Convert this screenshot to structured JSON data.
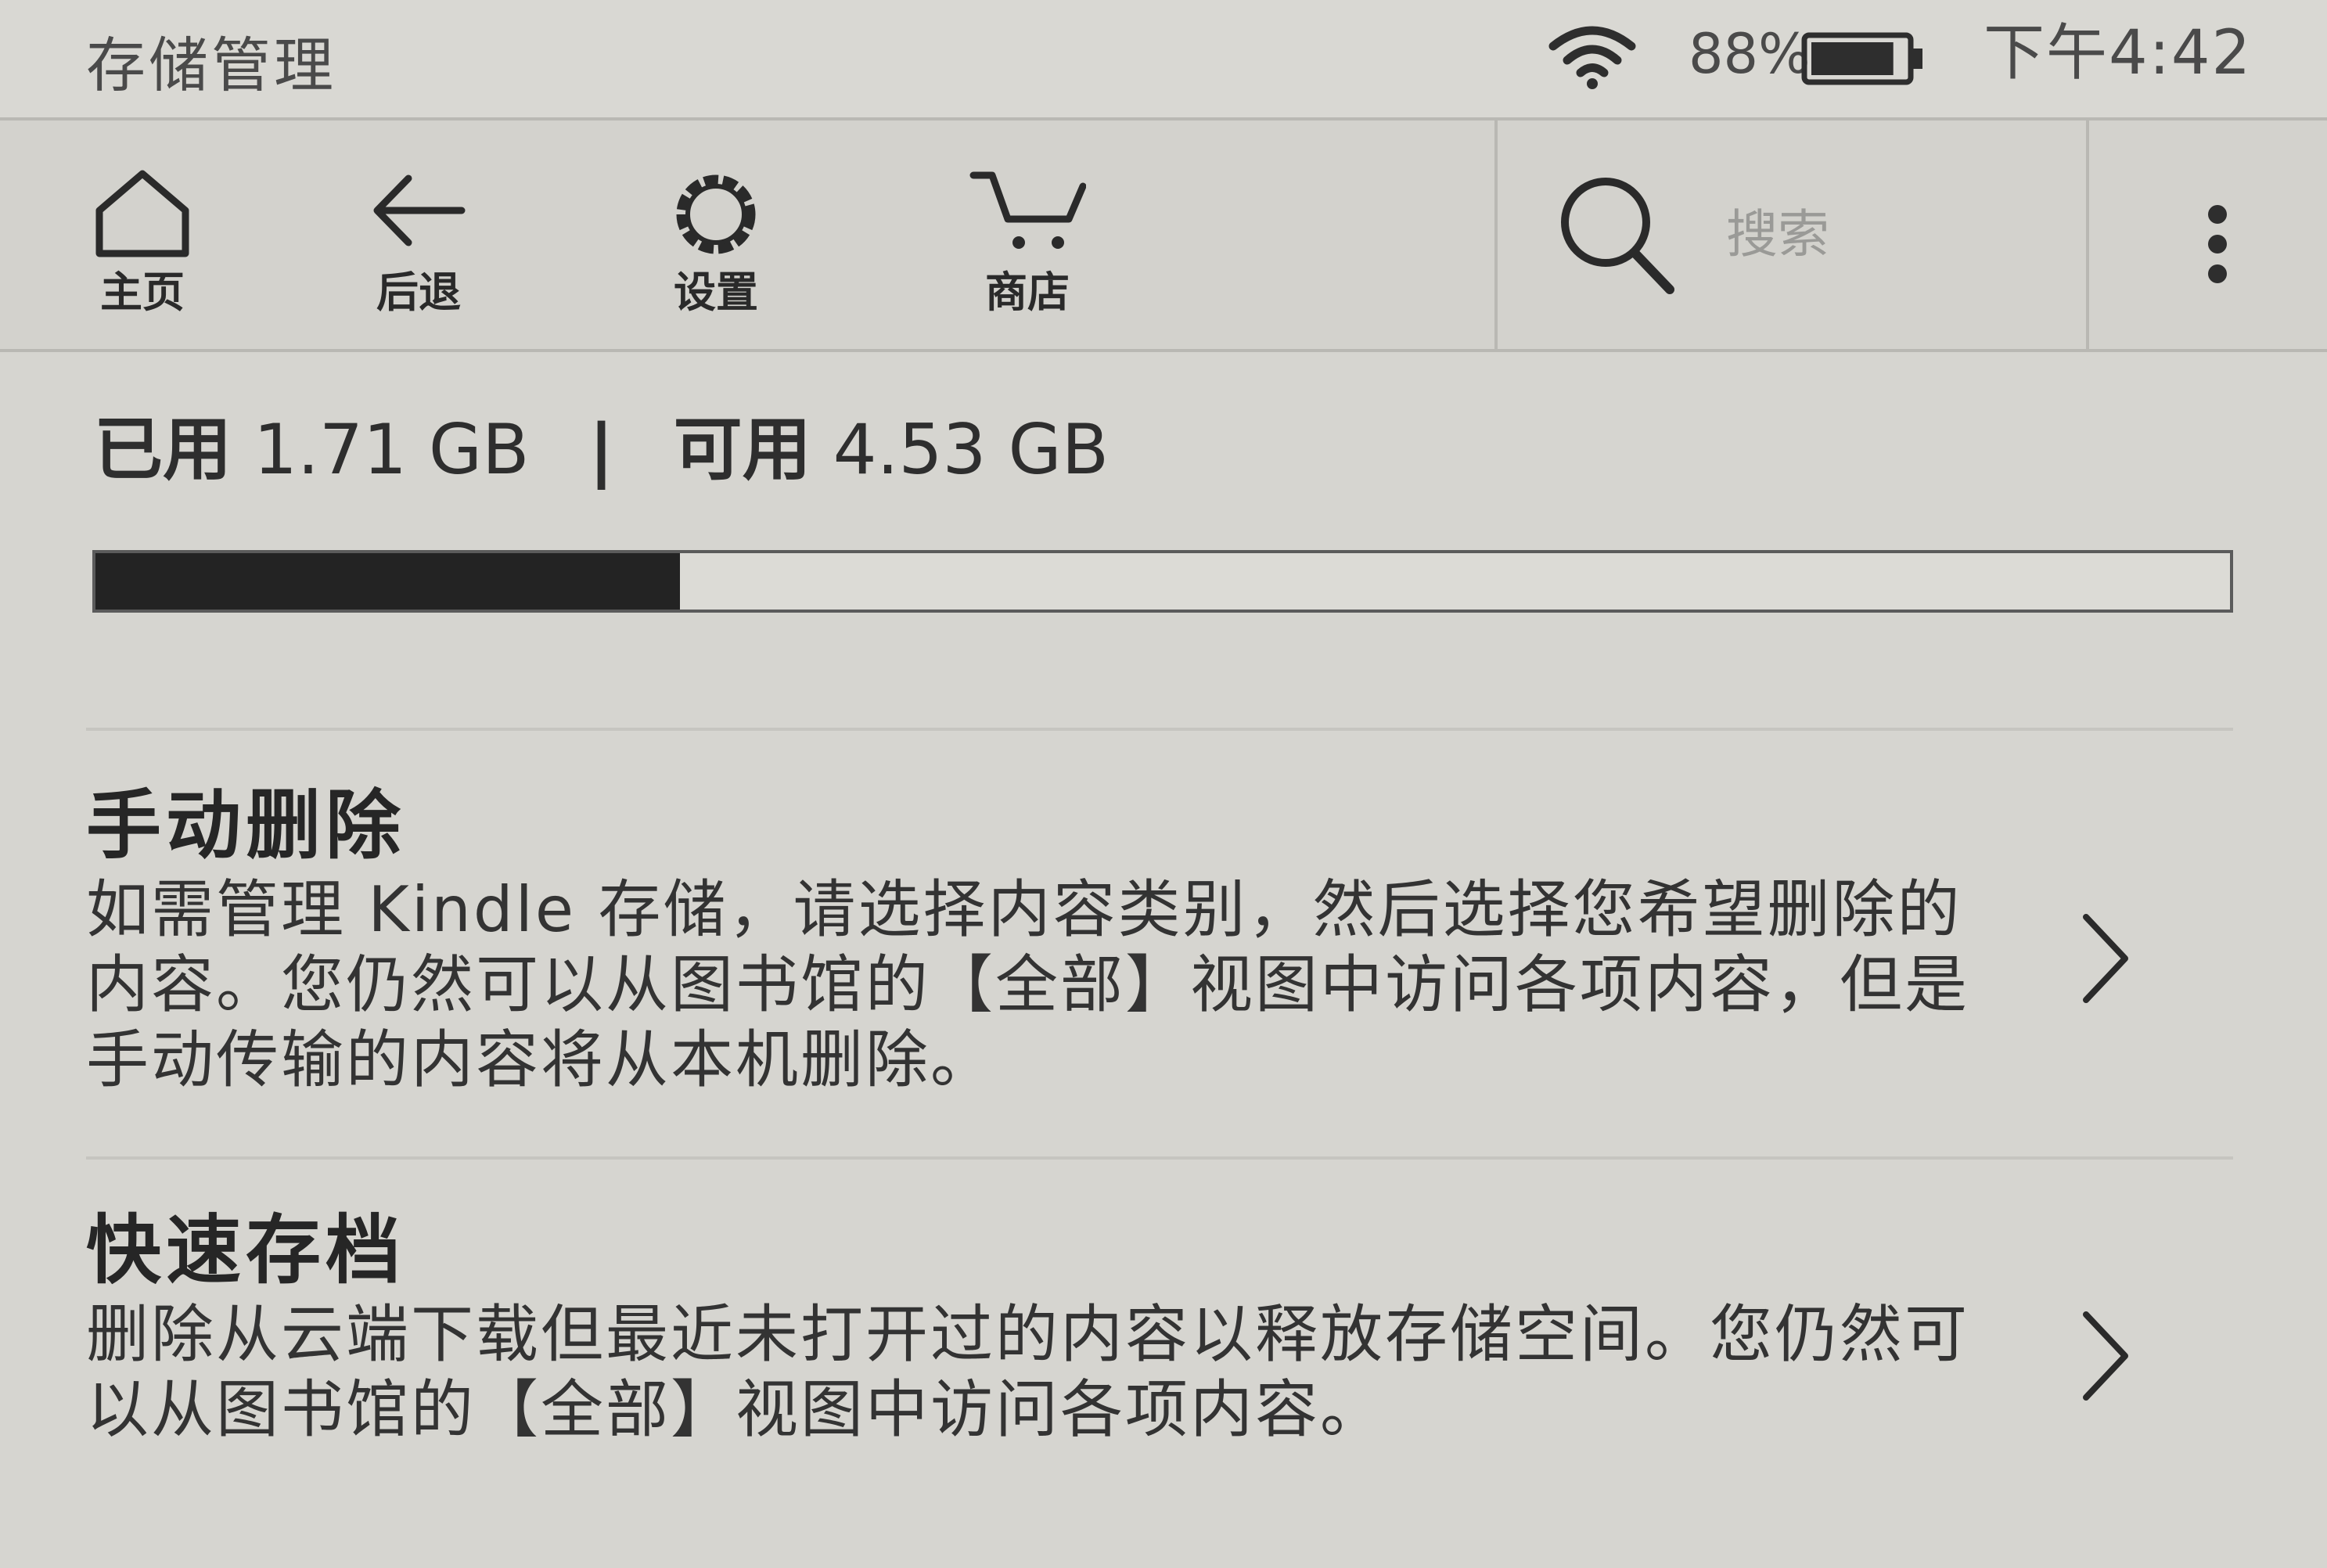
{
  "status_bar": {
    "title": "存储管理",
    "battery_percent": "88%",
    "battery_level": 0.88,
    "time": "下午4:42",
    "icons": [
      "wifi-icon",
      "battery-icon"
    ]
  },
  "toolbar": {
    "home_label": "主页",
    "back_label": "后退",
    "settings_label": "设置",
    "store_label": "商店",
    "search_placeholder": "搜索",
    "icons": [
      "home-icon",
      "back-arrow-icon",
      "gear-icon",
      "cart-icon",
      "search-icon",
      "more-vertical-icon"
    ]
  },
  "storage": {
    "used_label": "已用",
    "used_value": "1.71 GB",
    "separator": "|",
    "free_label": "可用",
    "free_value": "4.53 GB",
    "used_fraction": 0.274
  },
  "sections": [
    {
      "title": "手动删除",
      "description": "如需管理 Kindle 存储，请选择内容类别，然后选择您希望删除的内容。您仍然可以从图书馆的【全部】视图中访问各项内容，但是手动传输的内容将从本机删除。"
    },
    {
      "title": "快速存档",
      "description": "删除从云端下载但最近未打开过的内容以释放存储空间。您仍然可以从图书馆的【全部】视图中访问各项内容。"
    }
  ],
  "colors": {
    "background": "#d6d5d0",
    "text": "#2b2b2b",
    "progress_fill": "#232323"
  }
}
